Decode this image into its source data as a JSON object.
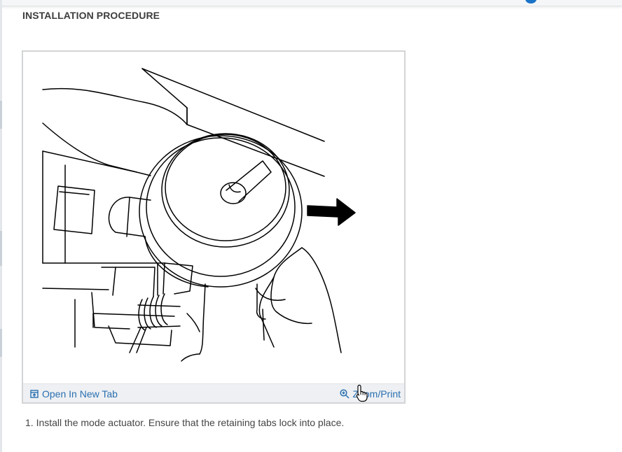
{
  "header": {
    "title": "INSTALLATION PROCEDURE"
  },
  "figure": {
    "open_tab_label": "Open In New Tab",
    "zoom_label": "Zoom/Print",
    "icons": [
      "open-new-tab-icon",
      "zoom-in-icon",
      "hand-pointer-cursor-icon"
    ]
  },
  "steps": [
    "1. Install the mode actuator. Ensure that the retaining tabs lock into place."
  ],
  "colors": {
    "link": "#2a6fb0",
    "toolbar_bg": "#eef0f3",
    "frame_border": "#d2d4d6",
    "title_text": "#3d3d3d",
    "body_text": "#444444"
  }
}
